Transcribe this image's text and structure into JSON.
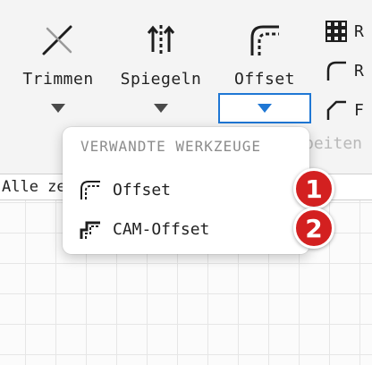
{
  "toolbar": {
    "tools": [
      {
        "label": "Trimmen",
        "icon": "trim-icon"
      },
      {
        "label": "Spiegeln",
        "icon": "mirror-icon"
      },
      {
        "label": "Offset",
        "icon": "offset-icon"
      }
    ],
    "mini_tools": [
      {
        "label": "R",
        "icon": "grid-array-icon"
      },
      {
        "label": "R",
        "icon": "round-corner-icon"
      },
      {
        "label": "F",
        "icon": "chamfer-icon"
      }
    ],
    "section_label_partial": "beiten",
    "accent_color": "#1f77d4"
  },
  "filter": {
    "value_partial": "Alle ze"
  },
  "dropdown": {
    "header": "VERWANDTE WERKZEUGE",
    "items": [
      {
        "label": "Offset",
        "icon": "offset-icon",
        "badge": "1"
      },
      {
        "label": "CAM-Offset",
        "icon": "cam-offset-icon",
        "badge": "2"
      }
    ],
    "badge_color": "#d32020"
  }
}
